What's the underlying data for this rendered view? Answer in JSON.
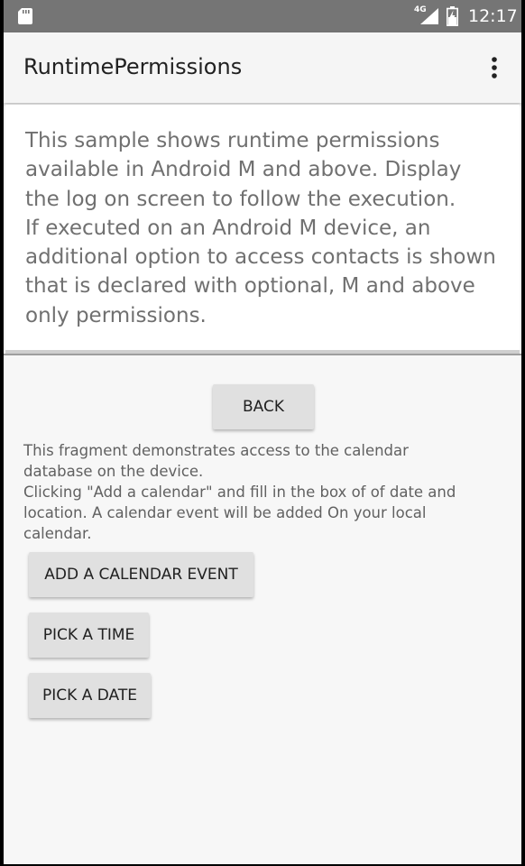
{
  "status_bar": {
    "network_type": "4G",
    "time": "12:17"
  },
  "app_bar": {
    "title": "RuntimePermissions"
  },
  "description": {
    "text": "This sample shows runtime permissions\navailable in Android M and above. Display\nthe log on screen to follow the execution.\nIf executed on an Android M device, an\nadditional option to access contacts is shown\nthat is declared with optional, M and above\nonly permissions."
  },
  "fragment": {
    "back_label": "BACK",
    "text": "This fragment demonstrates access to the calendar\ndatabase on the device.\n Clicking \"Add a calendar\" and fill in the box of of date and\nlocation. A calendar event will be added On your local\ncalendar.",
    "add_calendar_event_label": "ADD A CALENDAR EVENT",
    "pick_time_label": "PICK A TIME",
    "pick_date_label": "PICK A DATE"
  },
  "icons": {
    "sd_card": "sd-card-icon",
    "signal": "signal-icon",
    "battery": "battery-icon",
    "overflow": "overflow-menu-icon"
  },
  "colors": {
    "status_bar": "#757575",
    "app_bar": "#f5f5f5",
    "background": "#f7f7f7",
    "button": "#e0e0e0"
  }
}
